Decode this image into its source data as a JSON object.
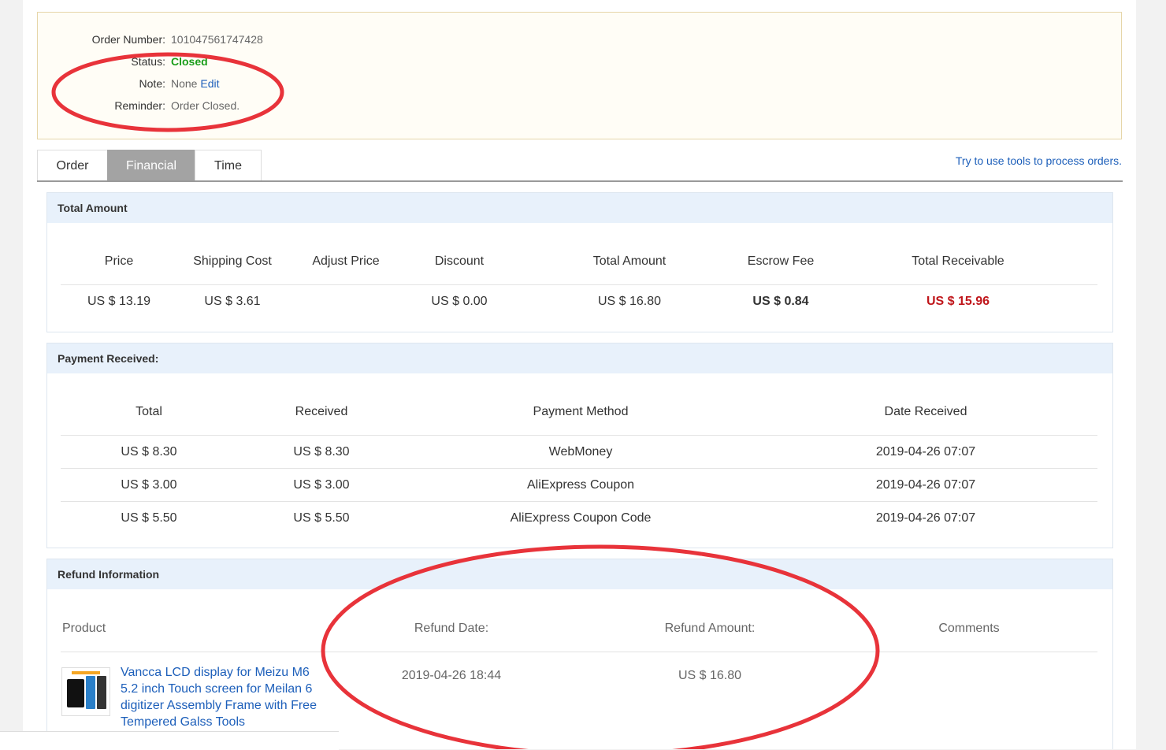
{
  "order_info": {
    "order_number_label": "Order Number:",
    "order_number": "101047561747428",
    "status_label": "Status:",
    "status": "Closed",
    "note_label": "Note:",
    "note": "None",
    "note_edit": "Edit",
    "reminder_label": "Reminder:",
    "reminder": "Order Closed."
  },
  "tabs": [
    {
      "label": "Order"
    },
    {
      "label": "Financial"
    },
    {
      "label": "Time"
    }
  ],
  "tools_link": "Try to use tools to process orders.",
  "total_amount": {
    "title": "Total Amount",
    "headers": [
      "Price",
      "Shipping Cost",
      "Adjust Price",
      "Discount",
      "Total Amount",
      "Escrow Fee",
      "Total Receivable"
    ],
    "values": [
      "US $ 13.19",
      "US $ 3.61",
      "",
      "US $ 0.00",
      "US $ 16.80",
      "US $ 0.84",
      "US $ 15.96"
    ]
  },
  "payment": {
    "title": "Payment Received:",
    "headers": [
      "Total",
      "Received",
      "Payment Method",
      "Date Received"
    ],
    "rows": [
      [
        "US $ 8.30",
        "US $ 8.30",
        "WebMoney",
        "2019-04-26 07:07"
      ],
      [
        "US $ 3.00",
        "US $ 3.00",
        "AliExpress Coupon",
        "2019-04-26 07:07"
      ],
      [
        "US $ 5.50",
        "US $ 5.50",
        "AliExpress Coupon Code",
        "2019-04-26 07:07"
      ]
    ]
  },
  "refund": {
    "title": "Refund Information",
    "headers": [
      "Product",
      "Refund Date:",
      "Refund Amount:",
      "Comments"
    ],
    "product_title": "Vancca LCD display for Meizu M6 5.2 inch Touch screen for Meilan 6 digitizer Assembly Frame with Free Tempered Galss Tools",
    "refund_date": "2019-04-26 18:44",
    "refund_amount": "US $ 16.80",
    "comments": ""
  },
  "annotation_color": "#e8333a"
}
